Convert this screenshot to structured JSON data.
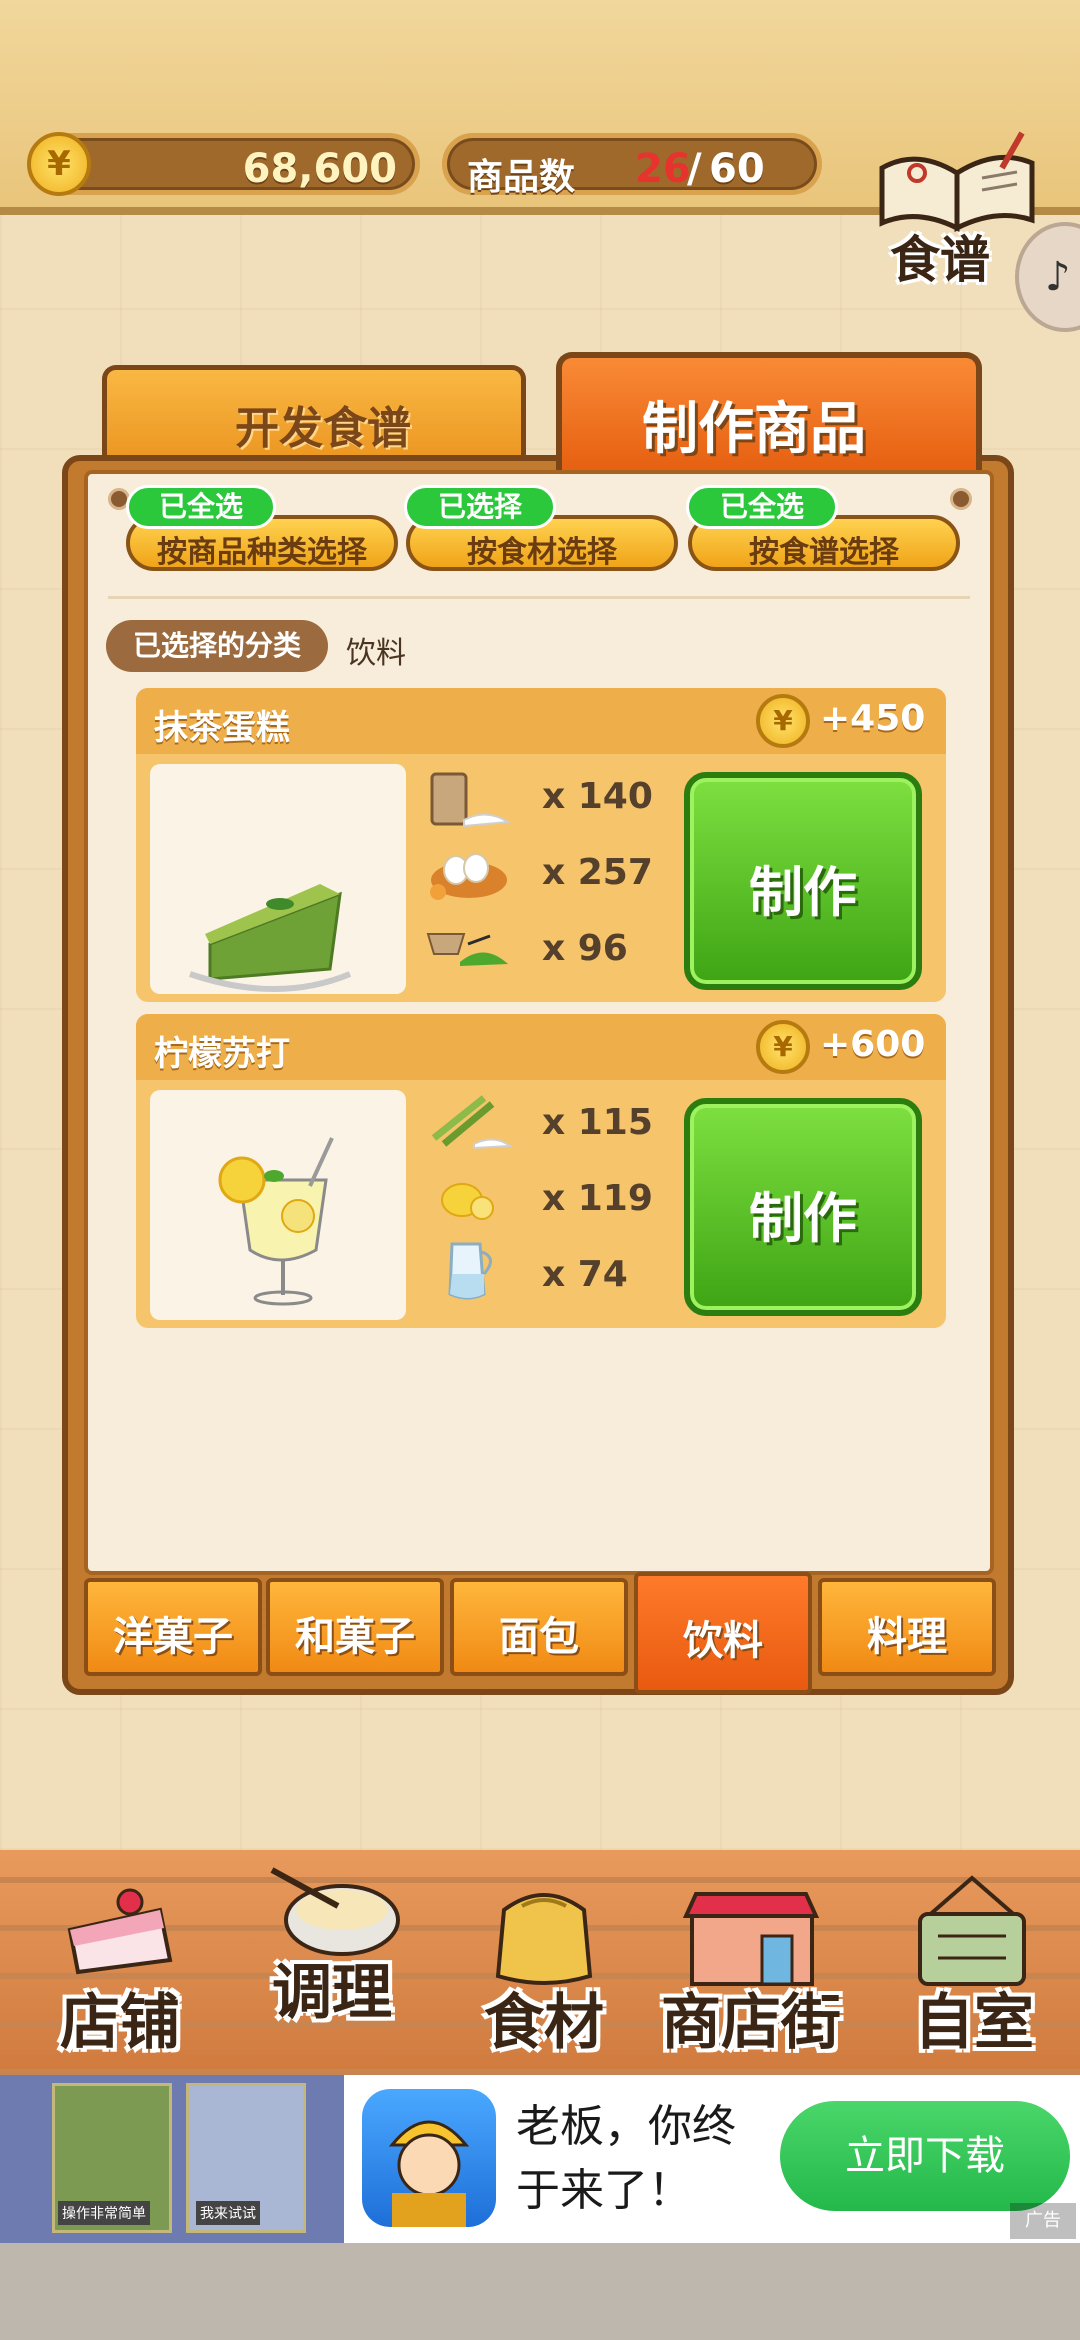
{
  "header": {
    "currency_symbol": "¥",
    "coins": "68,600",
    "goods_label": "商品数",
    "goods_current": "26",
    "goods_separator": "/",
    "goods_max": "60",
    "recipe_book_label": "食谱"
  },
  "main_tabs": {
    "develop_label": "开发食谱",
    "make_label": "制作商品",
    "active": "make"
  },
  "filters": [
    {
      "badge": "已全选",
      "label": "按商品种类选择"
    },
    {
      "badge": "已选择",
      "label": "按食材选择"
    },
    {
      "badge": "已全选",
      "label": "按食谱选择"
    }
  ],
  "category": {
    "tag_label": "已选择的分类",
    "value": "饮料"
  },
  "products": [
    {
      "name": "抹茶蛋糕",
      "reward": "+450",
      "ingredients": [
        {
          "icon": "flour-sack-icon",
          "qty": "x 140"
        },
        {
          "icon": "eggs-icon",
          "qty": "x 257"
        },
        {
          "icon": "matcha-powder-icon",
          "qty": "x 96"
        }
      ],
      "make_label": "制作"
    },
    {
      "name": "柠檬苏打",
      "reward": "+600",
      "ingredients": [
        {
          "icon": "sugarcane-icon",
          "qty": "x 115"
        },
        {
          "icon": "lemon-icon",
          "qty": "x 119"
        },
        {
          "icon": "water-pitcher-icon",
          "qty": "x 74"
        }
      ],
      "make_label": "制作"
    }
  ],
  "category_tabs": [
    {
      "label": "洋菓子",
      "active": false
    },
    {
      "label": "和菓子",
      "active": false
    },
    {
      "label": "面包",
      "active": false
    },
    {
      "label": "饮料",
      "active": true
    },
    {
      "label": "料理",
      "active": false
    }
  ],
  "nav": [
    {
      "label": "店铺",
      "icon": "cake-icon"
    },
    {
      "label": "调理",
      "icon": "mixing-bowl-icon"
    },
    {
      "label": "食材",
      "icon": "ingredient-sack-icon"
    },
    {
      "label": "商店街",
      "icon": "shop-icon"
    },
    {
      "label": "自室",
      "icon": "staff-only-sign-icon"
    }
  ],
  "ad": {
    "left_caption_1": "操作非常简单",
    "left_caption_2": "我来试试",
    "text": "老板，你终于来了！",
    "button_label": "立即下载",
    "ad_mark": "广告"
  },
  "colors": {
    "accent_orange": "#e55e10",
    "make_green": "#3ea414",
    "badge_green": "#2cc83c",
    "goods_current_red": "#e8322e"
  }
}
